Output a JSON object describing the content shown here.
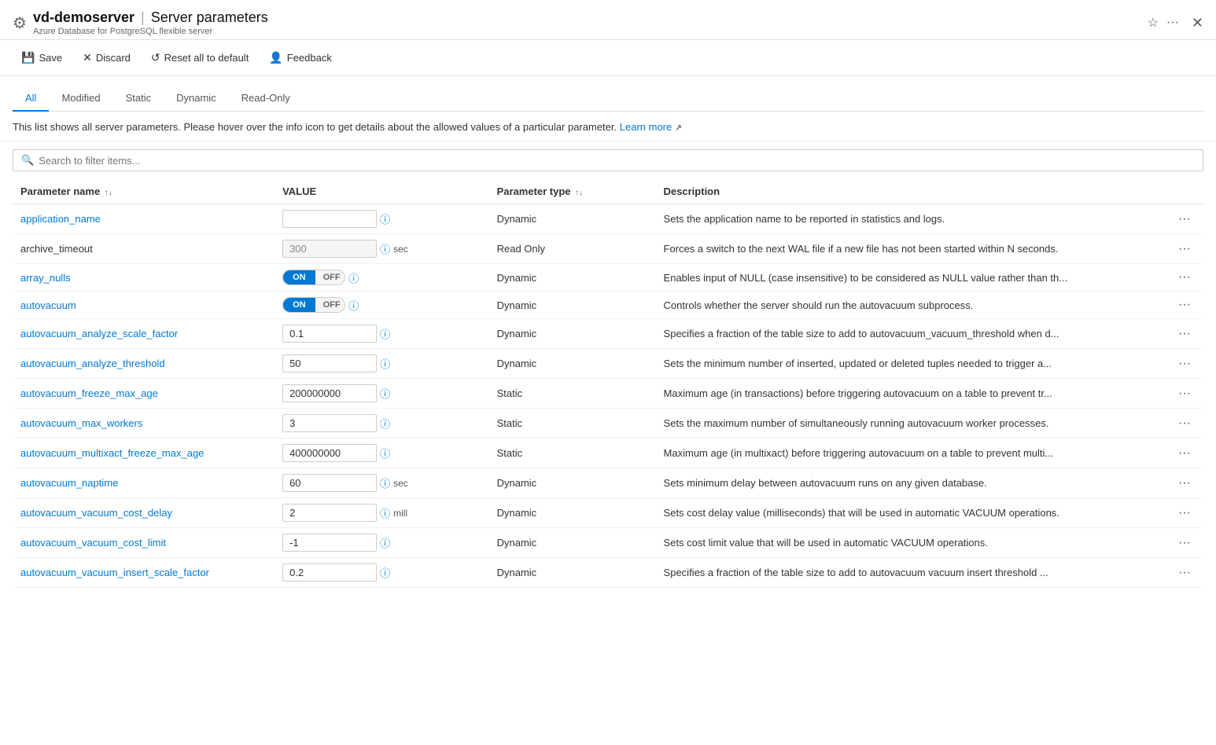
{
  "header": {
    "server_name": "vd-demoserver",
    "separator": "|",
    "page_title": "Server parameters",
    "subtitle": "Azure Database for PostgreSQL flexible server"
  },
  "toolbar": {
    "save_label": "Save",
    "discard_label": "Discard",
    "reset_label": "Reset all to default",
    "feedback_label": "Feedback"
  },
  "tabs": {
    "items": [
      "All",
      "Modified",
      "Static",
      "Dynamic",
      "Read-Only"
    ],
    "active": "All"
  },
  "description": {
    "text": "This list shows all server parameters. Please hover over the info icon to get details about the allowed values of a particular parameter.",
    "link_text": "Learn more",
    "link_href": "#"
  },
  "search": {
    "placeholder": "Search to filter items..."
  },
  "table": {
    "columns": {
      "name": "Parameter name",
      "value": "VALUE",
      "type": "Parameter type",
      "description": "Description"
    },
    "rows": [
      {
        "name": "application_name",
        "name_link": true,
        "value": "",
        "value_type": "input",
        "unit": "",
        "disabled": false,
        "param_type": "Dynamic",
        "description": "Sets the application name to be reported in statistics and logs."
      },
      {
        "name": "archive_timeout",
        "name_link": false,
        "value": "300",
        "value_type": "input",
        "unit": "sec",
        "disabled": true,
        "param_type": "Read Only",
        "description": "Forces a switch to the next WAL file if a new file has not been started within N seconds."
      },
      {
        "name": "array_nulls",
        "name_link": true,
        "value": "ON",
        "value_type": "toggle",
        "unit": "",
        "disabled": false,
        "param_type": "Dynamic",
        "description": "Enables input of NULL (case insensitive) to be considered as NULL value rather than th..."
      },
      {
        "name": "autovacuum",
        "name_link": true,
        "value": "ON",
        "value_type": "toggle",
        "unit": "",
        "disabled": false,
        "param_type": "Dynamic",
        "description": "Controls whether the server should run the autovacuum subprocess."
      },
      {
        "name": "autovacuum_analyze_scale_factor",
        "name_link": true,
        "value": "0.1",
        "value_type": "input",
        "unit": "",
        "disabled": false,
        "param_type": "Dynamic",
        "description": "Specifies a fraction of the table size to add to autovacuum_vacuum_threshold when d..."
      },
      {
        "name": "autovacuum_analyze_threshold",
        "name_link": true,
        "value": "50",
        "value_type": "input",
        "unit": "",
        "disabled": false,
        "param_type": "Dynamic",
        "description": "Sets the minimum number of inserted, updated or deleted tuples needed to trigger a..."
      },
      {
        "name": "autovacuum_freeze_max_age",
        "name_link": true,
        "value": "200000000",
        "value_type": "input",
        "unit": "",
        "disabled": false,
        "param_type": "Static",
        "description": "Maximum age (in transactions) before triggering autovacuum on a table to prevent tr..."
      },
      {
        "name": "autovacuum_max_workers",
        "name_link": true,
        "value": "3",
        "value_type": "input",
        "unit": "",
        "disabled": false,
        "param_type": "Static",
        "description": "Sets the maximum number of simultaneously running autovacuum worker processes."
      },
      {
        "name": "autovacuum_multixact_freeze_max_age",
        "name_link": true,
        "value": "400000000",
        "value_type": "input",
        "unit": "",
        "disabled": false,
        "param_type": "Static",
        "description": "Maximum age (in multixact) before triggering autovacuum on a table to prevent multi..."
      },
      {
        "name": "autovacuum_naptime",
        "name_link": true,
        "value": "60",
        "value_type": "input",
        "unit": "sec",
        "disabled": false,
        "param_type": "Dynamic",
        "description": "Sets minimum delay between autovacuum runs on any given database."
      },
      {
        "name": "autovacuum_vacuum_cost_delay",
        "name_link": true,
        "value": "2",
        "value_type": "input",
        "unit": "mill",
        "disabled": false,
        "param_type": "Dynamic",
        "description": "Sets cost delay value (milliseconds) that will be used in automatic VACUUM operations."
      },
      {
        "name": "autovacuum_vacuum_cost_limit",
        "name_link": true,
        "value": "-1",
        "value_type": "input",
        "unit": "",
        "disabled": false,
        "param_type": "Dynamic",
        "description": "Sets cost limit value that will be used in automatic VACUUM operations."
      },
      {
        "name": "autovacuum_vacuum_insert_scale_factor",
        "name_link": true,
        "value": "0.2",
        "value_type": "input",
        "unit": "",
        "disabled": false,
        "param_type": "Dynamic",
        "description": "Specifies a fraction of the table size to add to autovacuum vacuum insert threshold ..."
      }
    ]
  }
}
